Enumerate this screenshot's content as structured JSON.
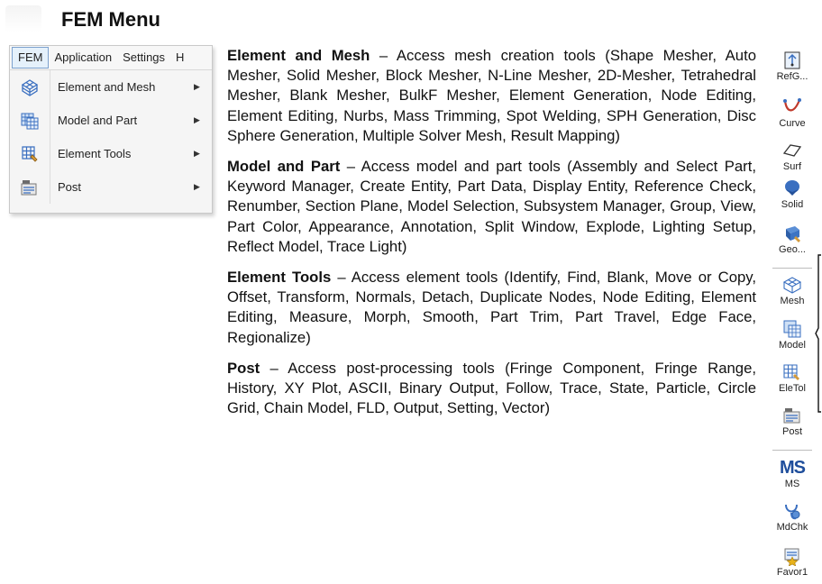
{
  "page": {
    "title": "FEM Menu"
  },
  "menubar": {
    "items": [
      "FEM",
      "Application",
      "Settings",
      "H"
    ]
  },
  "menu": {
    "items": [
      {
        "label": "Element and Mesh",
        "icon": "mesh-grid-icon"
      },
      {
        "label": "Model and Part",
        "icon": "model-part-icon"
      },
      {
        "label": "Element Tools",
        "icon": "element-tools-icon"
      },
      {
        "label": "Post",
        "icon": "post-icon"
      }
    ]
  },
  "descriptions": [
    {
      "term": "Element and Mesh",
      "text": " – Access mesh creation tools (Shape Mesher, Auto Mesher, Solid Mesher, Block Mesher, N-Line Mesher, 2D-Mesher, Tetrahedral Mesher, Blank Mesher, BulkF Mesher, Element Generation, Node Editing, Element Editing, Nurbs, Mass Trimming, Spot Welding, SPH Generation, Disc Sphere Generation, Multiple Solver Mesh, Result Mapping)"
    },
    {
      "term": "Model and Part",
      "text": " – Access model and part tools (Assembly and Select Part, Keyword Manager, Create Entity, Part Data, Display Entity, Reference Check, Renumber, Section Plane, Model Selection, Subsystem Manager, Group, View, Part Color, Appearance, Annotation, Split Window, Explode, Lighting Setup, Reflect Model, Trace Light)"
    },
    {
      "term": "Element Tools",
      "text": " – Access element tools (Identify, Find, Blank, Move or Copy, Offset, Transform, Normals, Detach, Duplicate Nodes, Node Editing, Element Editing, Measure, Morph, Smooth, Part Trim, Part Travel, Edge Face, Regionalize)"
    },
    {
      "term": "Post",
      "text": " – Access post-processing tools (Fringe Component, Fringe Range, History, XY Plot, ASCII, Binary Output, Follow, Trace, State, Particle, Circle Grid, Chain Model, FLD, Output, Setting, Vector)"
    }
  ],
  "toolbar": {
    "items": [
      {
        "label": "RefG...",
        "icon": "ref-geometry-icon"
      },
      {
        "label": "Curve",
        "icon": "curve-icon"
      },
      {
        "label": "Surf",
        "icon": "surface-icon"
      },
      {
        "label": "Solid",
        "icon": "solid-icon"
      },
      {
        "label": "Geo...",
        "icon": "geometry-tools-icon"
      },
      {
        "label": "Mesh",
        "icon": "mesh-icon"
      },
      {
        "label": "Model",
        "icon": "model-icon"
      },
      {
        "label": "EleTol",
        "icon": "element-tools-icon"
      },
      {
        "label": "Post",
        "icon": "post-icon"
      },
      {
        "label": "MS",
        "icon": "ms-icon"
      },
      {
        "label": "MdChk",
        "icon": "model-check-icon"
      },
      {
        "label": "Favor1",
        "icon": "favorites-icon"
      }
    ],
    "ms_glyph": "MS"
  },
  "colors": {
    "menu_highlight": "#e5f1fb",
    "menu_highlight_border": "#7da2ce",
    "icon_blue": "#3a6fc0",
    "curve_red": "#c0392b"
  }
}
